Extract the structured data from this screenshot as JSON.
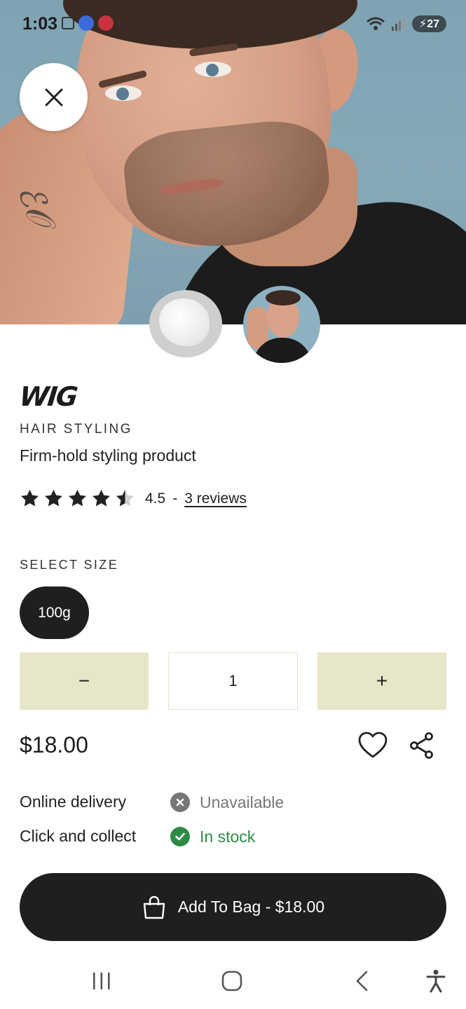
{
  "status_bar": {
    "time": "1:03",
    "battery": "27"
  },
  "product": {
    "brand": "WIG",
    "category": "HAIR STYLING",
    "description": "Firm-hold styling product",
    "rating": "4.5",
    "rating_value": 4.5,
    "rating_max": 5,
    "rating_separator": "-",
    "reviews_link": "3 reviews",
    "price": "$18.00"
  },
  "size": {
    "label": "SELECT SIZE",
    "selected": "100g"
  },
  "quantity": {
    "minus_label": "−",
    "value": "1",
    "plus_label": "+"
  },
  "availability": [
    {
      "label": "Online delivery",
      "status": "Unavailable",
      "status_color": "#777777"
    },
    {
      "label": "Click and collect",
      "status": "In stock",
      "status_color": "#2e8a46"
    }
  ],
  "cta": {
    "add_to_bag": "Add To Bag - $18.00"
  },
  "icons": {
    "close": "close-icon",
    "favorite": "heart-icon",
    "share": "share-icon",
    "bag": "shopping-bag-icon",
    "unavailable": "x-circle-icon",
    "in_stock": "check-circle-icon"
  },
  "colors": {
    "dark": "#1f1f1f",
    "qty_bg": "#e8e6c8",
    "in_stock": "#2e8a46"
  }
}
